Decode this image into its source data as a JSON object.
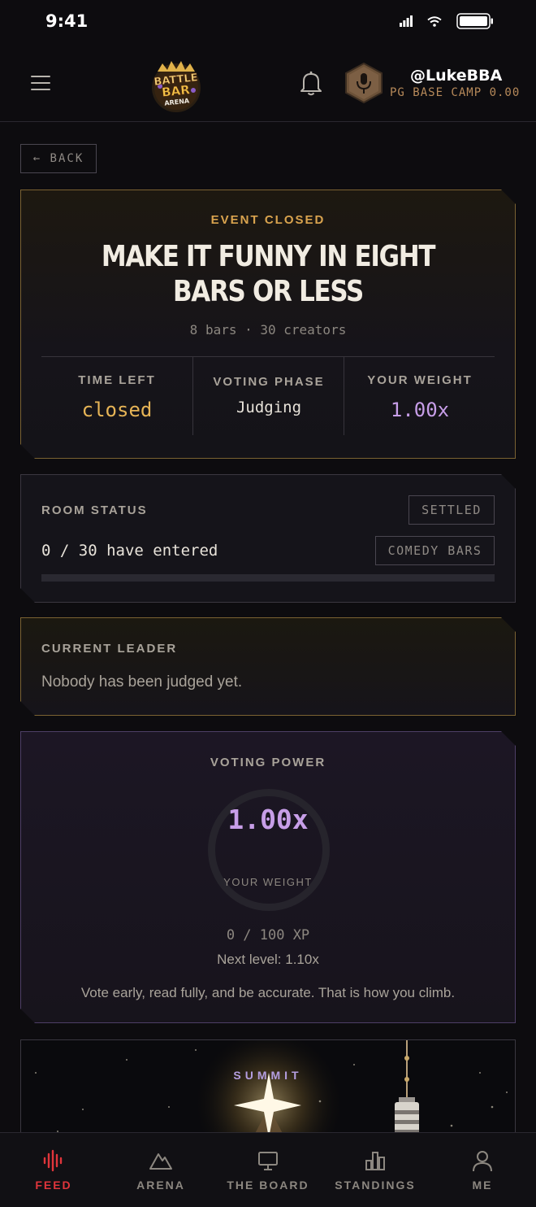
{
  "status_bar": {
    "time": "9:41"
  },
  "header": {
    "username": "@LukeBBA",
    "level": "PG BASE CAMP 0.00",
    "logo_text": [
      "BATTLE",
      "BAR",
      "ARENA"
    ]
  },
  "back_label": "← BACK",
  "event": {
    "tag": "EVENT CLOSED",
    "title": "MAKE IT FUNNY IN EIGHT BARS OR LESS",
    "subtitle": "8 bars · 30 creators",
    "stats": [
      {
        "label": "TIME LEFT",
        "value": "closed",
        "color": "#e6b456"
      },
      {
        "label": "VOTING PHASE",
        "value": "Judging",
        "color": "#e8e3da"
      },
      {
        "label": "YOUR WEIGHT",
        "value": "1.00x",
        "color": "#c79ee8"
      }
    ]
  },
  "room": {
    "title": "ROOM STATUS",
    "count": "0 / 30 have entered",
    "entered": 0,
    "total": 30,
    "badge_status": "SETTLED",
    "badge_category": "COMEDY BARS"
  },
  "leader": {
    "title": "CURRENT LEADER",
    "text": "Nobody has been judged yet."
  },
  "power": {
    "title": "VOTING POWER",
    "value": "1.00x",
    "sub": "YOUR WEIGHT",
    "xp": "0 / 100 XP",
    "next_level": "Next level: 1.10x",
    "tip": "Vote early, read fully, and be accurate. That is how you climb."
  },
  "summit": {
    "label": "SUMMIT"
  },
  "nav": [
    {
      "label": "FEED",
      "icon": "waveform-icon",
      "active": true
    },
    {
      "label": "ARENA",
      "icon": "mountain-icon",
      "active": false
    },
    {
      "label": "THE BOARD",
      "icon": "monitor-icon",
      "active": false
    },
    {
      "label": "STANDINGS",
      "icon": "bar-chart-icon",
      "active": false
    },
    {
      "label": "ME",
      "icon": "user-icon",
      "active": false
    }
  ],
  "colors": {
    "accent_gold": "#d9a34e",
    "accent_purple": "#c79ee8",
    "active_red": "#e0353b"
  }
}
